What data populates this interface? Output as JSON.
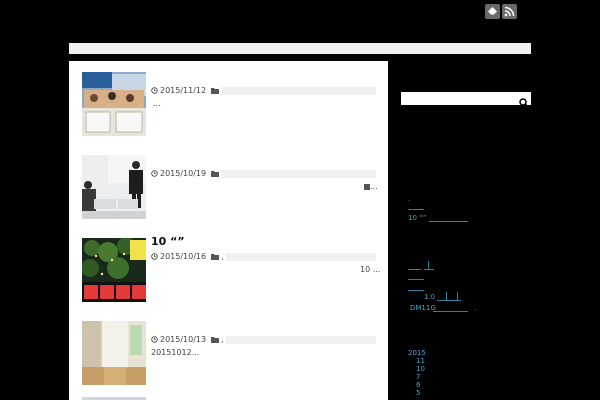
{
  "posts": [
    {
      "date": "2015/11/12",
      "title": "",
      "excerpt": "..."
    },
    {
      "date": "2015/10/19",
      "title": "",
      "excerpt": "..."
    },
    {
      "date": "2015/10/16",
      "title": "10 “”",
      "excerpt": "10 ...",
      "cat_sep": ","
    },
    {
      "date": "2015/10/13",
      "title": "",
      "excerpt": "20151012...",
      "cat_sep": ","
    }
  ],
  "sidebar": {
    "recent_sep": ".",
    "recent_link": "10 “”",
    "mid_link": "1.0",
    "dm_link": "DM11G",
    "dm_sep": ".",
    "archive_year": "2015",
    "archive_months": [
      "11",
      "10",
      "7",
      "6",
      "5"
    ]
  },
  "icons": {
    "feedly": "feedly-icon",
    "rss": "rss-icon",
    "search": "search-icon"
  },
  "colors": {
    "background": "#000000",
    "link": "#4aa3c7",
    "panel": "#ffffff"
  }
}
